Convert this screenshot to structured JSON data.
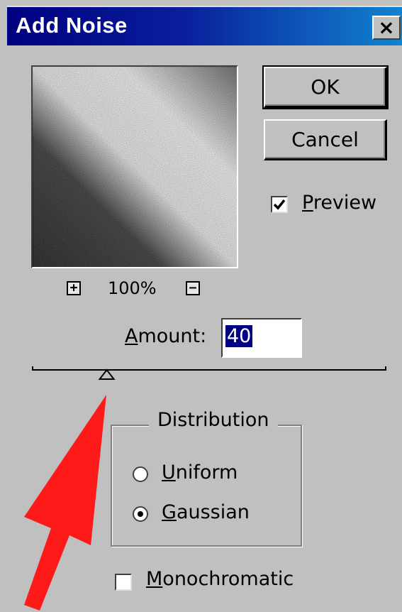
{
  "dialog": {
    "title": "Add Noise",
    "close_glyph": "×"
  },
  "buttons": {
    "ok_label": "OK",
    "cancel_label": "Cancel"
  },
  "preview_option": {
    "checked": true,
    "label_mnemonic": "P",
    "label_rest": "review"
  },
  "zoom": {
    "zoom_in_glyph": "+",
    "zoom_out_glyph": "−",
    "level": "100%"
  },
  "amount": {
    "label_mnemonic": "A",
    "label_rest": "mount:",
    "value": "40",
    "slider_fraction": 0.21
  },
  "distribution": {
    "legend": "Distribution",
    "options": [
      {
        "mnemonic": "U",
        "rest": "niform",
        "selected": false
      },
      {
        "mnemonic": "G",
        "rest": "aussian",
        "selected": true
      }
    ]
  },
  "monochromatic": {
    "checked": false,
    "label_mnemonic": "M",
    "label_rest": "onochromatic"
  },
  "colors": {
    "dialog_bg": "#c0c0c0",
    "title_bar": "#000080",
    "selection": "#000080",
    "arrow": "#ff1a1a"
  },
  "icons": {
    "close": "close-icon",
    "zoom_in": "zoom-in-icon",
    "zoom_out": "zoom-out-icon",
    "check": "checkmark-icon",
    "slider_thumb": "slider-thumb-icon",
    "annotation": "red-arrow-icon"
  }
}
